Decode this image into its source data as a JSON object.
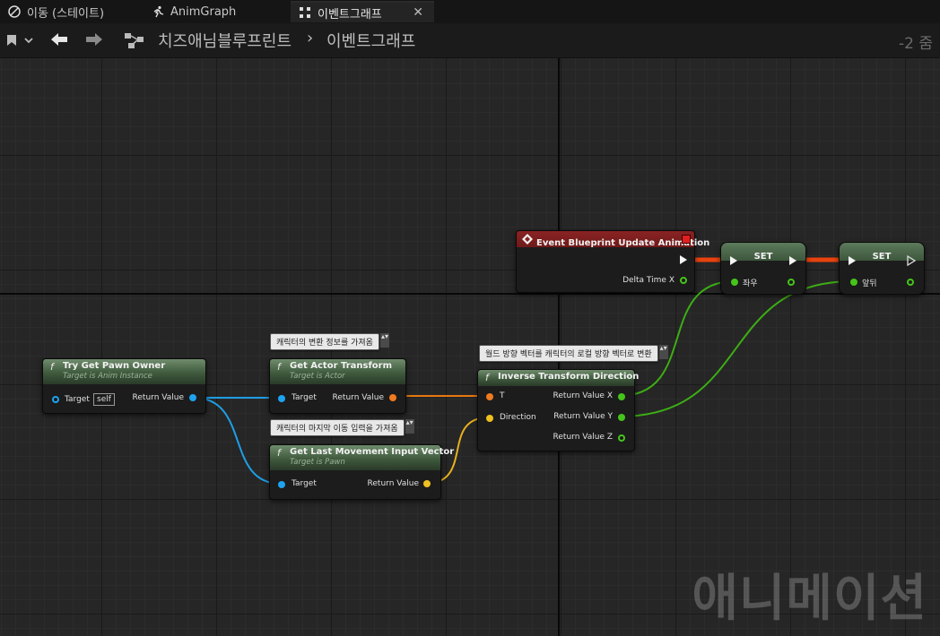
{
  "tabs": [
    {
      "label": "이동 (스테이트)",
      "icon": "state-icon"
    },
    {
      "label": "AnimGraph",
      "icon": "running-man-icon"
    },
    {
      "label": "이벤트그래프",
      "icon": "graph-icon",
      "close": "✕"
    }
  ],
  "toolbar": {
    "breadcrumb_root": "치즈애님블루프린트",
    "breadcrumb_sep": "›",
    "breadcrumb_current": "이벤트그래프",
    "zoom": "-2 줌"
  },
  "nodes": {
    "try_get_pawn_owner": {
      "title": "Try Get Pawn Owner",
      "subtitle": "Target is Anim Instance",
      "in_label": "Target",
      "self_value": "self",
      "out_label": "Return Value"
    },
    "get_actor_transform": {
      "title": "Get Actor Transform",
      "subtitle": "Target is Actor",
      "in_label": "Target",
      "out_label": "Return Value",
      "comment": "캐릭터의 변환 정보를 가져옴"
    },
    "get_last_movement": {
      "title": "Get Last Movement Input Vector",
      "subtitle": "Target is Pawn",
      "in_label": "Target",
      "out_label": "Return Value",
      "comment": "캐릭터의 마지막 이동 입력을 가져옴"
    },
    "inverse_transform": {
      "title": "Inverse Transform Direction",
      "in_t": "T",
      "in_dir": "Direction",
      "out_x": "Return Value X",
      "out_y": "Return Value Y",
      "out_z": "Return Value Z",
      "comment": "월드 방향 벡터를 캐릭터의 로컬 방향 벡터로 변환"
    },
    "event_update": {
      "title": "Event Blueprint Update Animation",
      "out_label": "Delta Time X"
    },
    "set1": {
      "title": "SET",
      "var_label": "좌우"
    },
    "set2": {
      "title": "SET",
      "var_label": "앞뒤"
    }
  },
  "watermark": "애니메이션",
  "colors": {
    "exec_wire": "#e8420e",
    "object_wire": "#1e9ee6",
    "transform_wire": "#e8780e",
    "vector_wire": "#e8b01e",
    "float_wire": "#3cae14"
  }
}
